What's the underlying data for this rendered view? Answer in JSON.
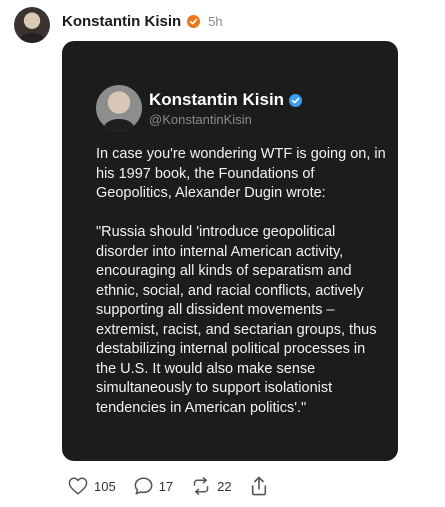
{
  "post": {
    "author": "Konstantin Kisin",
    "time": "5h"
  },
  "card": {
    "name": "Konstantin Kisin",
    "handle": "@KonstantinKisin",
    "text": "In case you're wondering WTF is going on, in his 1997 book, the Foundations of Geopolitics, Alexander Dugin wrote:\n\n\"Russia should 'introduce geopolitical disorder into internal American activity, encouraging all kinds of separatism and ethnic, social, and racial conflicts, actively supporting all dissident movements – extremist, racist, and sectarian groups, thus destabilizing internal political processes in the U.S. It would also make sense simultaneously to support isolationist tendencies in American politics'.\""
  },
  "actions": {
    "likes": "105",
    "replies": "17",
    "reposts": "22"
  },
  "colors": {
    "verified_post": "#f0761b",
    "verified_card": "#3b9cf5",
    "card_bg": "#1c1c1c"
  },
  "icons": {
    "like": "heart-icon",
    "reply": "comment-icon",
    "repost": "repost-icon",
    "share": "share-icon"
  }
}
